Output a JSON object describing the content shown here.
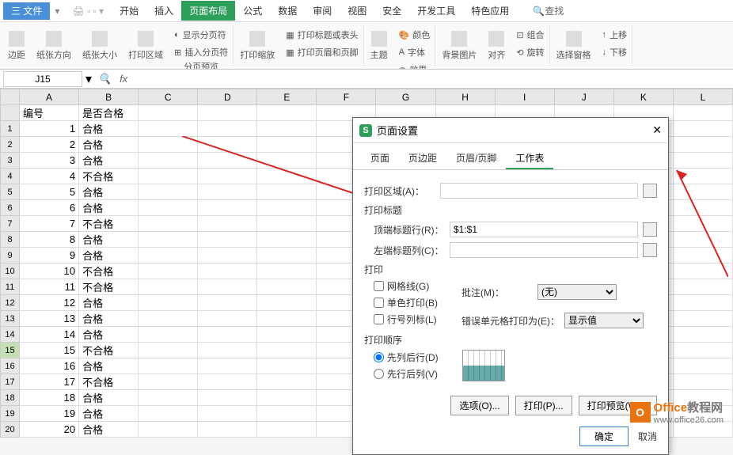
{
  "menu": {
    "file": "三 文件",
    "items": [
      "开始",
      "插入",
      "页面布局",
      "公式",
      "数据",
      "审阅",
      "视图",
      "安全",
      "开发工具",
      "特色应用"
    ],
    "active_index": 2,
    "search": "查找"
  },
  "ribbon": {
    "margins": "边距",
    "orientation": "纸张方向",
    "size": "纸张大小",
    "print_area": "打印区域",
    "page_break": "分页预览",
    "show_breaks": "显示分页符",
    "insert_break": "插入分页符",
    "print_scale": "打印缩放",
    "print_titles": "打印标题或表头",
    "header_footer": "打印页眉和页脚",
    "themes": "主题",
    "colors": "颜色",
    "fonts": "字体",
    "effects": "效果",
    "bg_pic": "背景图片",
    "align": "对齐",
    "group": "组合",
    "rotate": "旋转",
    "selection": "选择窗格",
    "move_up": "上移",
    "move_down": "下移"
  },
  "cell_ref": "J15",
  "columns": [
    "A",
    "B",
    "C",
    "D",
    "E",
    "F",
    "G",
    "H",
    "I",
    "J",
    "K",
    "L"
  ],
  "headers": {
    "c1": "编号",
    "c2": "是否合格"
  },
  "rows": [
    {
      "n": 1,
      "id": 1,
      "v": "合格"
    },
    {
      "n": 2,
      "id": 2,
      "v": "合格"
    },
    {
      "n": 3,
      "id": 3,
      "v": "合格"
    },
    {
      "n": 4,
      "id": 4,
      "v": "不合格"
    },
    {
      "n": 5,
      "id": 5,
      "v": "合格"
    },
    {
      "n": 6,
      "id": 6,
      "v": "合格"
    },
    {
      "n": 7,
      "id": 7,
      "v": "不合格"
    },
    {
      "n": 8,
      "id": 8,
      "v": "合格"
    },
    {
      "n": 9,
      "id": 9,
      "v": "合格"
    },
    {
      "n": 10,
      "id": 10,
      "v": "不合格"
    },
    {
      "n": 11,
      "id": 11,
      "v": "不合格"
    },
    {
      "n": 12,
      "id": 12,
      "v": "合格"
    },
    {
      "n": 13,
      "id": 13,
      "v": "合格"
    },
    {
      "n": 14,
      "id": 14,
      "v": "合格"
    },
    {
      "n": 15,
      "id": 15,
      "v": "不合格"
    },
    {
      "n": 16,
      "id": 16,
      "v": "合格"
    },
    {
      "n": 17,
      "id": 17,
      "v": "不合格"
    },
    {
      "n": 18,
      "id": 18,
      "v": "合格"
    },
    {
      "n": 19,
      "id": 19,
      "v": "合格"
    },
    {
      "n": 20,
      "id": 20,
      "v": "合格"
    }
  ],
  "dialog": {
    "title": "页面设置",
    "tabs": [
      "页面",
      "页边距",
      "页眉/页脚",
      "工作表"
    ],
    "active_tab": 3,
    "print_area_label": "打印区域(A)：",
    "print_area_value": "",
    "titles_label": "打印标题",
    "top_row_label": "顶端标题行(R)：",
    "top_row_value": "$1:$1",
    "left_col_label": "左端标题列(C)：",
    "left_col_value": "",
    "print_label": "打印",
    "gridlines": "网格线(G)",
    "bw": "单色打印(B)",
    "row_col_head": "行号列标(L)",
    "comments_label": "批注(M)：",
    "comments_value": "(无)",
    "errors_label": "错误单元格打印为(E)：",
    "errors_value": "显示值",
    "order_label": "打印顺序",
    "order_down": "先列后行(D)",
    "order_over": "先行后列(V)",
    "btn_options": "选项(O)...",
    "btn_print": "打印(P)...",
    "btn_preview": "打印预览(W)...",
    "ok": "确定",
    "cancel": "取消"
  },
  "watermark": {
    "brand1": "Office",
    "brand2": "教程网",
    "url": "www.office26.com"
  }
}
